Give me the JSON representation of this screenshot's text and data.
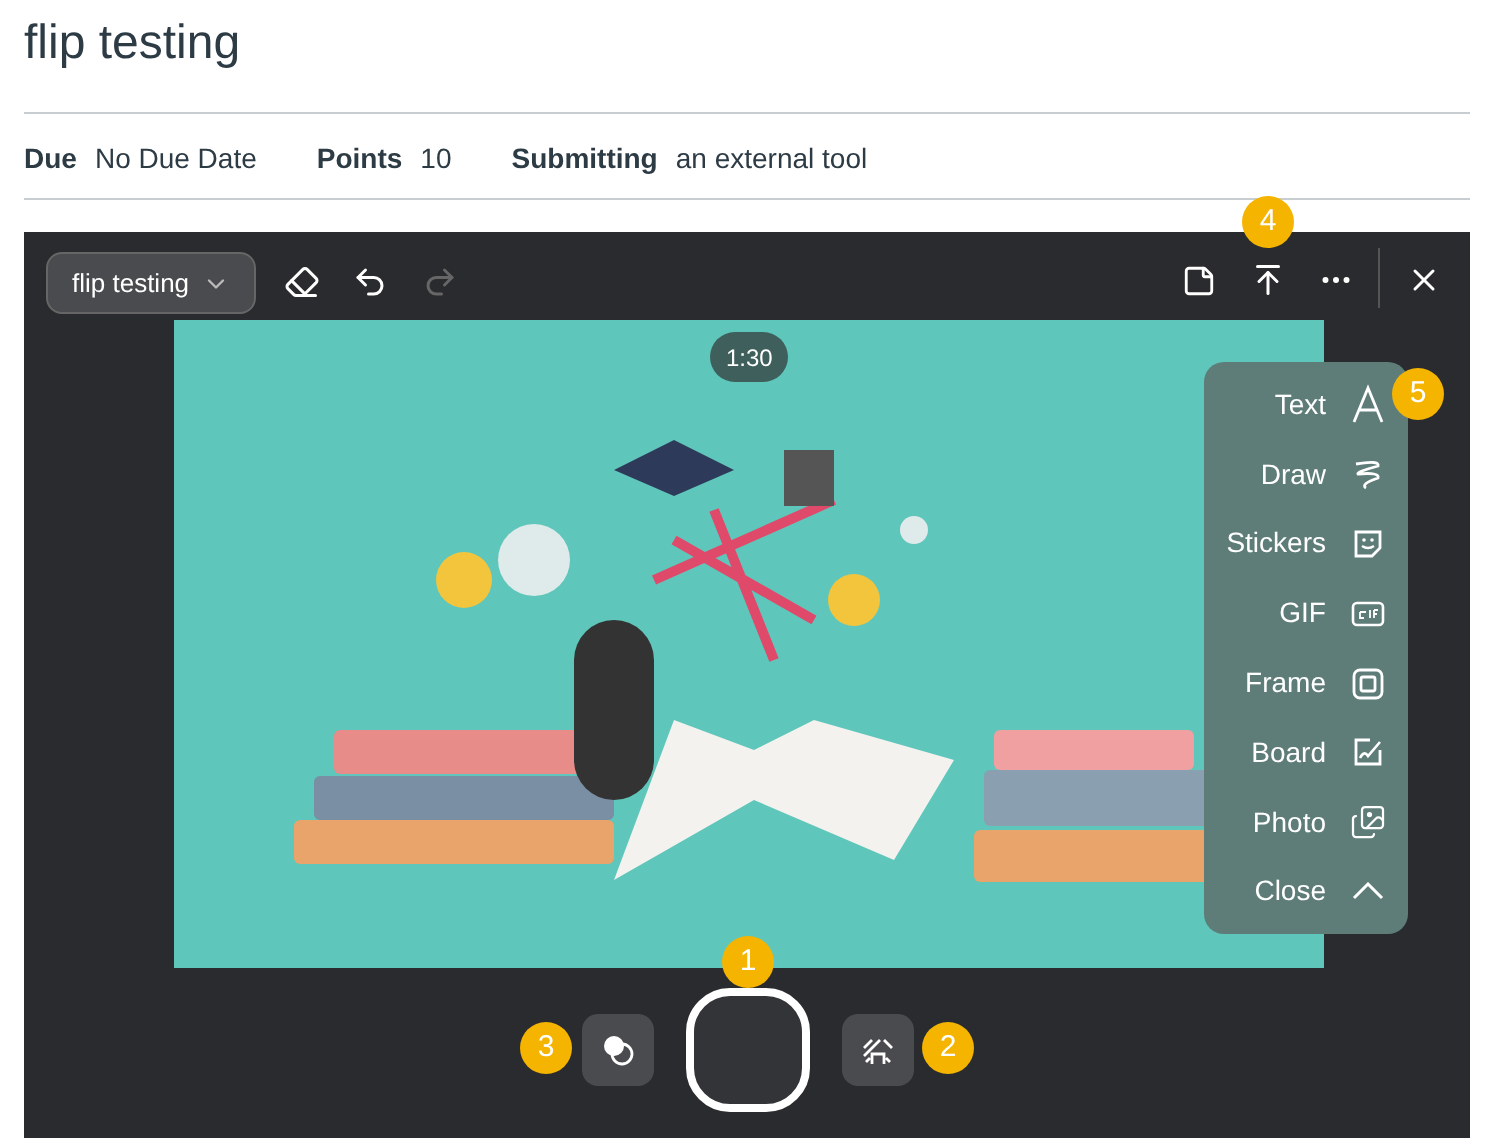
{
  "page": {
    "title": "flip testing"
  },
  "details": [
    {
      "label": "Due",
      "value": "No Due Date"
    },
    {
      "label": "Points",
      "value": "10"
    },
    {
      "label": "Submitting",
      "value": "an external tool"
    }
  ],
  "recorder": {
    "topic_button": "flip testing",
    "timer": "1:30",
    "tools": [
      {
        "label": "Text",
        "kind": "text"
      },
      {
        "label": "Draw",
        "kind": "draw"
      },
      {
        "label": "Stickers",
        "kind": "stickers"
      },
      {
        "label": "GIF",
        "kind": "gif"
      },
      {
        "label": "Frame",
        "kind": "frame"
      },
      {
        "label": "Board",
        "kind": "board"
      },
      {
        "label": "Photo"
      },
      {
        "label": "Close",
        "kind": "close"
      }
    ],
    "callouts": [
      "1",
      "2",
      "3",
      "4",
      "5"
    ]
  }
}
